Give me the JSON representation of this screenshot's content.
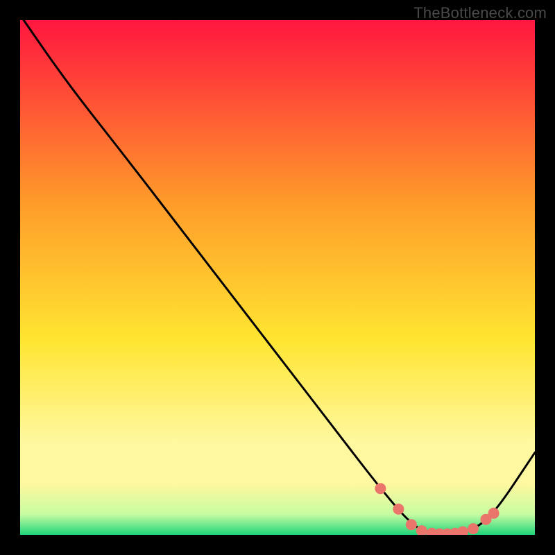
{
  "watermark": "TheBottleneck.com",
  "colors": {
    "background": "#000000",
    "curve": "#000000",
    "marker": "#e9756b",
    "grad_top": "#ff163f",
    "grad_mid_up": "#ff9a2a",
    "grad_mid": "#ffe531",
    "grad_low1": "#fff8a0",
    "grad_low2": "#c7fca1",
    "grad_bottom": "#1fd47a"
  },
  "chart_data": {
    "type": "line",
    "title": "",
    "xlabel": "",
    "ylabel": "",
    "xlim": [
      0,
      100
    ],
    "ylim": [
      0,
      100
    ],
    "series": [
      {
        "name": "bottleneck-curve",
        "x": [
          0,
          9,
          20,
          30,
          40,
          50,
          60,
          70,
          76,
          80,
          84,
          88,
          92,
          100
        ],
        "y": [
          101,
          88,
          74,
          61,
          48,
          35,
          22,
          9,
          2,
          0,
          0,
          1,
          4,
          16
        ]
      }
    ],
    "markers": {
      "name": "highlight-points",
      "x": [
        70.0,
        73.5,
        76.0,
        78.0,
        80.0,
        81.5,
        83.0,
        84.5,
        86.0,
        88.0,
        90.5,
        92.0
      ],
      "y": [
        9.0,
        5.0,
        2.0,
        0.8,
        0.3,
        0.2,
        0.2,
        0.3,
        0.6,
        1.2,
        3.0,
        4.2
      ]
    }
  }
}
